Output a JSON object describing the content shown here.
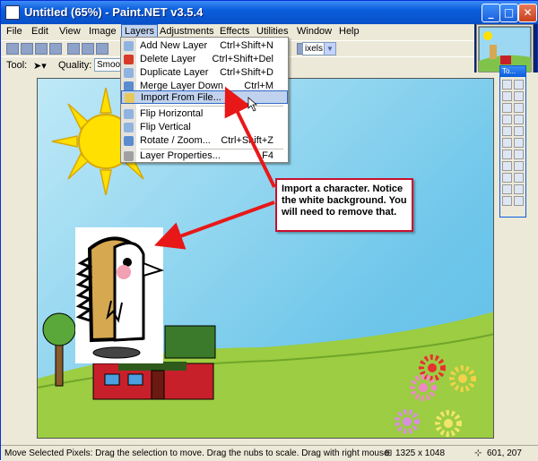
{
  "window": {
    "title": "Untitled (65%) - Paint.NET v3.5.4"
  },
  "menubar": [
    "File",
    "Edit",
    "View",
    "Image",
    "Layers",
    "Adjustments",
    "Effects",
    "Utilities",
    "Window",
    "Help"
  ],
  "toolbar": {
    "tool_label": "Tool:",
    "quality_label": "Quality:",
    "quality_value": "Smooth",
    "units_value": "ixels"
  },
  "layers_menu": [
    {
      "label": "Add New Layer",
      "shortcut": "Ctrl+Shift+N",
      "icon": "add-layer-icon"
    },
    {
      "label": "Delete Layer",
      "shortcut": "Ctrl+Shift+Del",
      "icon": "delete-layer-icon"
    },
    {
      "label": "Duplicate Layer",
      "shortcut": "Ctrl+Shift+D",
      "icon": "duplicate-layer-icon"
    },
    {
      "label": "Merge Layer Down",
      "shortcut": "Ctrl+M",
      "icon": "merge-layer-icon"
    },
    {
      "label": "Import From File...",
      "shortcut": "",
      "icon": "import-file-icon"
    },
    {
      "label": "Flip Horizontal",
      "shortcut": "",
      "icon": "flip-horizontal-icon"
    },
    {
      "label": "Flip Vertical",
      "shortcut": "",
      "icon": "flip-vertical-icon"
    },
    {
      "label": "Rotate / Zoom...",
      "shortcut": "Ctrl+Shift+Z",
      "icon": "rotate-zoom-icon"
    },
    {
      "label": "Layer Properties...",
      "shortcut": "F4",
      "icon": "layer-properties-icon"
    }
  ],
  "tools_panel": {
    "title": "To..."
  },
  "annotation": "Import a character. Notice the white background. You will need to remove that.",
  "status": {
    "message": "Move Selected Pixels: Drag the selection to move. Drag the nubs to scale. Drag with right mouse",
    "image_size": "1325 x 1048",
    "cursor_pos": "601, 207"
  },
  "colors": {
    "accent_red": "#c8102e",
    "title_blue": "#0a5ddc",
    "menu_highlight": "#c1d2ee"
  }
}
